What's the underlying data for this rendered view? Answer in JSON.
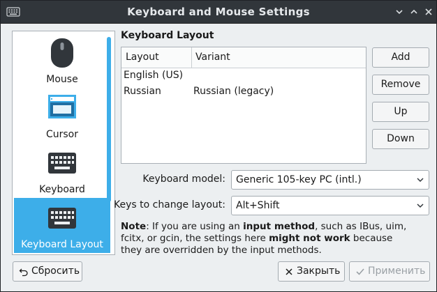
{
  "window": {
    "title": "Keyboard and Mouse Settings"
  },
  "titlebar": {
    "minimize_glyph": "⌄",
    "maximize_glyph": "⌃",
    "close_glyph": "✕"
  },
  "sidebar": {
    "items": [
      {
        "label": "Mouse",
        "icon": "mouse-icon"
      },
      {
        "label": "Cursor",
        "icon": "cursor-icon"
      },
      {
        "label": "Keyboard",
        "icon": "keyboard-icon"
      },
      {
        "label": "Keyboard Layout",
        "icon": "keyboard-layout-icon",
        "selected": true
      }
    ]
  },
  "keyboard_layout": {
    "title": "Keyboard Layout",
    "columns": [
      "Layout",
      "Variant"
    ],
    "rows": [
      {
        "layout": "English (US)",
        "variant": ""
      },
      {
        "layout": "Russian",
        "variant": "Russian (legacy)"
      }
    ],
    "buttons": {
      "add": "Add",
      "remove": "Remove",
      "up": "Up",
      "down": "Down"
    }
  },
  "form": {
    "model_label": "Keyboard model:",
    "model_value": "Generic 105-key PC (intl.)",
    "switch_label": "Keys to change layout:",
    "switch_value": "Alt+Shift"
  },
  "note": {
    "p1": "Note",
    "p2": ": If you are using an ",
    "p3": "input method",
    "p4": ", such as IBus, uim, fcitx, or gcin, the settings here ",
    "p5": "might not work",
    "p6": " because they are overridden by the input methods."
  },
  "footer": {
    "reset": "Сбросить",
    "close": "Закрыть",
    "apply": "Применить"
  },
  "colors": {
    "accent": "#3daee9",
    "titlebar": "#31363b",
    "background": "#eceff1"
  }
}
